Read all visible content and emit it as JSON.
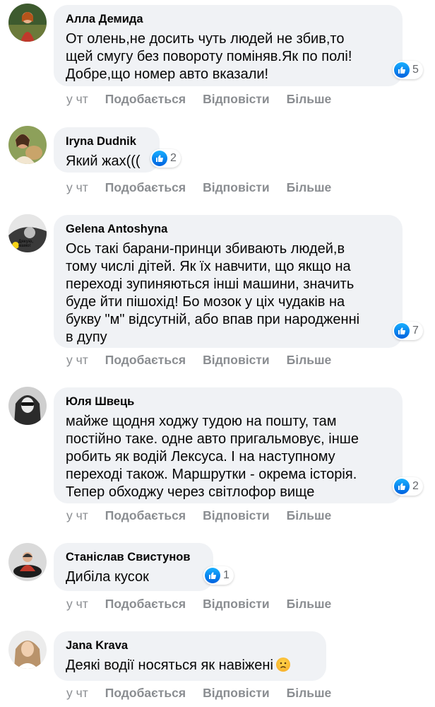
{
  "actions": {
    "like": "Подобається",
    "reply": "Відповісти",
    "more": "Більше"
  },
  "comments": [
    {
      "author": "Алла Демида",
      "text": "От олень,не досить чуть людей не збив,то\nщей смугу без повороту поміняв.Як по полі!\nДобре,що номер авто вказали!",
      "likes": "5",
      "time": "у чт"
    },
    {
      "author": "Iryna Dudnik",
      "text": "Який жах(((",
      "likes": "2",
      "time": "у чт"
    },
    {
      "author": "Gelena Antoshyna",
      "avatar_badge": "Дякую,\nмамо!",
      "text": "Ось такі барани-принци збивають людей,в\nтому числі дітей. Як їх навчити, що якщо на\nпереході зупиняються інші машини, значить\nбуде йти пішохід! Бо мозок у ціх чудаків на\nбукву \"м\" відсутній, або впав при народженні\nв дупу",
      "likes": "7",
      "time": "у чт"
    },
    {
      "author": "Юля Швець",
      "text": "майже щодня ходжу тудою на пошту, там\nпостійно таке. одне авто пригальмовує, інше\nробить як водій Лексуса. І на наступному\nпереході також. Маршрутки - окрема історія.\nТепер обходжу через світлофор вище",
      "likes": "2",
      "time": "у чт"
    },
    {
      "author": "Станіслав Свистунов",
      "text": "Дибіла кусок",
      "likes": "1",
      "time": "у чт"
    },
    {
      "author": "Jana Krava",
      "text": "Деякі водії носяться як навіжені",
      "emoji": "sad-face-emoji",
      "time": "у чт"
    }
  ],
  "colors": {
    "bubble": "#f0f2f5",
    "like_blue": "#1877f2",
    "meta_gray": "#8a8d91"
  }
}
